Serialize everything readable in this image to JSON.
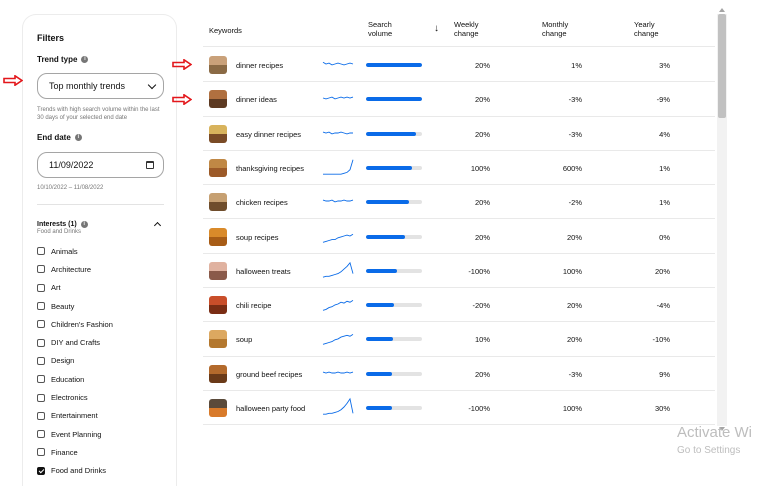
{
  "sidebar": {
    "title": "Filters",
    "trend_type_label": "Trend type",
    "trend_type_value": "Top monthly trends",
    "trend_type_help": "Trends with high search volume within the last 30 days of your selected end date",
    "end_date_label": "End date",
    "end_date_value": "11/09/2022",
    "date_range": "10/10/2022 – 11/08/2022",
    "interests_label": "Interests (1)",
    "interests_selected": "Food and Drinks",
    "interests": [
      {
        "label": "Animals",
        "checked": false
      },
      {
        "label": "Architecture",
        "checked": false
      },
      {
        "label": "Art",
        "checked": false
      },
      {
        "label": "Beauty",
        "checked": false
      },
      {
        "label": "Children's Fashion",
        "checked": false
      },
      {
        "label": "DIY and Crafts",
        "checked": false
      },
      {
        "label": "Design",
        "checked": false
      },
      {
        "label": "Education",
        "checked": false
      },
      {
        "label": "Electronics",
        "checked": false
      },
      {
        "label": "Entertainment",
        "checked": false
      },
      {
        "label": "Event Planning",
        "checked": false
      },
      {
        "label": "Finance",
        "checked": false
      },
      {
        "label": "Food and Drinks",
        "checked": true
      }
    ]
  },
  "table": {
    "headers": {
      "keywords": "Keywords",
      "search_volume": "Search volume",
      "weekly": "Weekly change",
      "monthly": "Monthly change",
      "yearly": "Yearly change"
    },
    "sort_icon": "arrow-down-icon",
    "rows": [
      {
        "keyword": "dinner recipes",
        "volume": 1.0,
        "weekly": "20%",
        "monthly": "1%",
        "yearly": "3%",
        "spark": [
          12,
          10,
          11,
          9,
          10,
          11,
          10,
          9,
          10,
          11,
          10
        ],
        "thumb": [
          "#c9a17a",
          "#8a6a45"
        ]
      },
      {
        "keyword": "dinner ideas",
        "volume": 1.0,
        "weekly": "20%",
        "monthly": "-3%",
        "yearly": "-9%",
        "spark": [
          10,
          9,
          10,
          11,
          9,
          10,
          11,
          10,
          11,
          10,
          11
        ],
        "thumb": [
          "#b07040",
          "#5d3a22"
        ]
      },
      {
        "keyword": "easy dinner recipes",
        "volume": 0.9,
        "weekly": "20%",
        "monthly": "-3%",
        "yearly": "4%",
        "spark": [
          11,
          10,
          11,
          9,
          10,
          10,
          11,
          10,
          9,
          10,
          10
        ],
        "thumb": [
          "#d8b35c",
          "#7a4b26"
        ]
      },
      {
        "keyword": "thanksgiving recipes",
        "volume": 0.82,
        "weekly": "100%",
        "monthly": "600%",
        "yearly": "1%",
        "spark": [
          2,
          2,
          2,
          2,
          2,
          2,
          2,
          3,
          4,
          7,
          18
        ],
        "thumb": [
          "#c08845",
          "#9c5a28"
        ]
      },
      {
        "keyword": "chicken recipes",
        "volume": 0.76,
        "weekly": "20%",
        "monthly": "-2%",
        "yearly": "1%",
        "spark": [
          11,
          10,
          10,
          11,
          9,
          10,
          10,
          11,
          10,
          10,
          11
        ],
        "thumb": [
          "#c6a072",
          "#6f4d2c"
        ]
      },
      {
        "keyword": "soup recipes",
        "volume": 0.7,
        "weekly": "20%",
        "monthly": "20%",
        "yearly": "0%",
        "spark": [
          3,
          4,
          5,
          6,
          6,
          8,
          9,
          10,
          11,
          10,
          12
        ],
        "thumb": [
          "#d98a2a",
          "#a75c16"
        ]
      },
      {
        "keyword": "halloween treats",
        "volume": 0.56,
        "weekly": "-100%",
        "monthly": "100%",
        "yearly": "20%",
        "spark": [
          2,
          3,
          3,
          4,
          5,
          6,
          8,
          11,
          14,
          18,
          6
        ],
        "thumb": [
          "#e0b2a0",
          "#8a5a4a"
        ]
      },
      {
        "keyword": "chili recipe",
        "volume": 0.5,
        "weekly": "-20%",
        "monthly": "20%",
        "yearly": "-4%",
        "spark": [
          3,
          4,
          6,
          7,
          9,
          10,
          12,
          11,
          13,
          12,
          14
        ],
        "thumb": [
          "#c94e2a",
          "#7a2d14"
        ]
      },
      {
        "keyword": "soup",
        "volume": 0.48,
        "weekly": "10%",
        "monthly": "20%",
        "yearly": "-10%",
        "spark": [
          3,
          4,
          5,
          6,
          8,
          9,
          11,
          12,
          13,
          12,
          14
        ],
        "thumb": [
          "#dca860",
          "#b4782e"
        ]
      },
      {
        "keyword": "ground beef recipes",
        "volume": 0.47,
        "weekly": "20%",
        "monthly": "-3%",
        "yearly": "9%",
        "spark": [
          11,
          10,
          11,
          10,
          10,
          11,
          10,
          10,
          11,
          10,
          11
        ],
        "thumb": [
          "#b36a2c",
          "#6a3a18"
        ]
      },
      {
        "keyword": "halloween party food",
        "volume": 0.46,
        "weekly": "-100%",
        "monthly": "100%",
        "yearly": "30%",
        "spark": [
          2,
          2,
          3,
          3,
          4,
          5,
          7,
          10,
          14,
          19,
          3
        ],
        "thumb": [
          "#5a4a3a",
          "#d87a2a"
        ]
      }
    ]
  },
  "watermark": {
    "line1": "Activate Wi",
    "line2": "Go to Settings"
  },
  "colors": {
    "accent_blue": "#0a6be8",
    "annotation_red": "#e3171b"
  }
}
